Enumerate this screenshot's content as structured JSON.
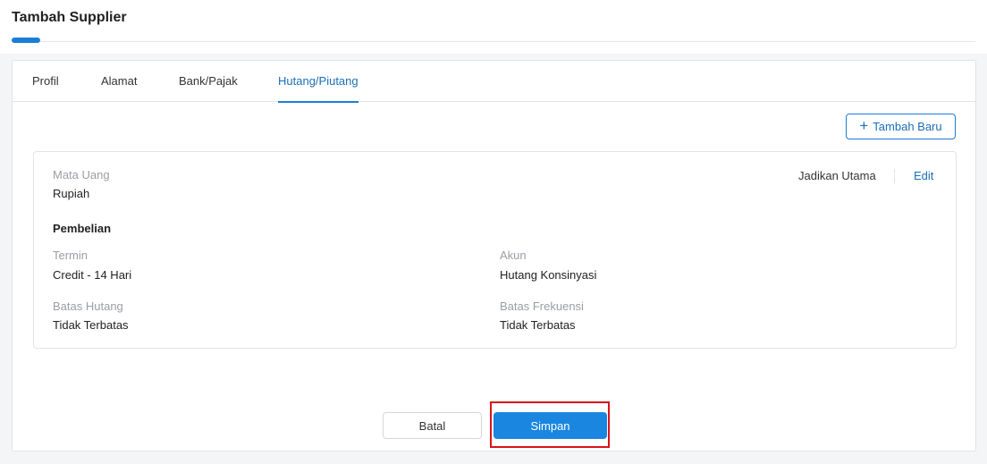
{
  "page": {
    "title": "Tambah Supplier"
  },
  "tabs": [
    {
      "label": "Profil"
    },
    {
      "label": "Alamat"
    },
    {
      "label": "Bank/Pajak"
    },
    {
      "label": "Hutang/Piutang"
    }
  ],
  "add_button": {
    "label": "Tambah Baru",
    "icon": "plus-icon"
  },
  "entry": {
    "currency_label": "Mata Uang",
    "currency_value": "Rupiah",
    "make_primary": "Jadikan Utama",
    "edit": "Edit",
    "section_title": "Pembelian",
    "term_label": "Termin",
    "term_value": "Credit - 14 Hari",
    "account_label": "Akun",
    "account_value": "Hutang Konsinyasi",
    "debt_limit_label": "Batas Hutang",
    "debt_limit_value": "Tidak Terbatas",
    "frequency_limit_label": "Batas Frekuensi",
    "frequency_limit_value": "Tidak Terbatas"
  },
  "footer": {
    "cancel_label": "Batal",
    "save_label": "Simpan"
  },
  "colors": {
    "accent": "#1a86e0",
    "highlight": "#d9141b"
  }
}
